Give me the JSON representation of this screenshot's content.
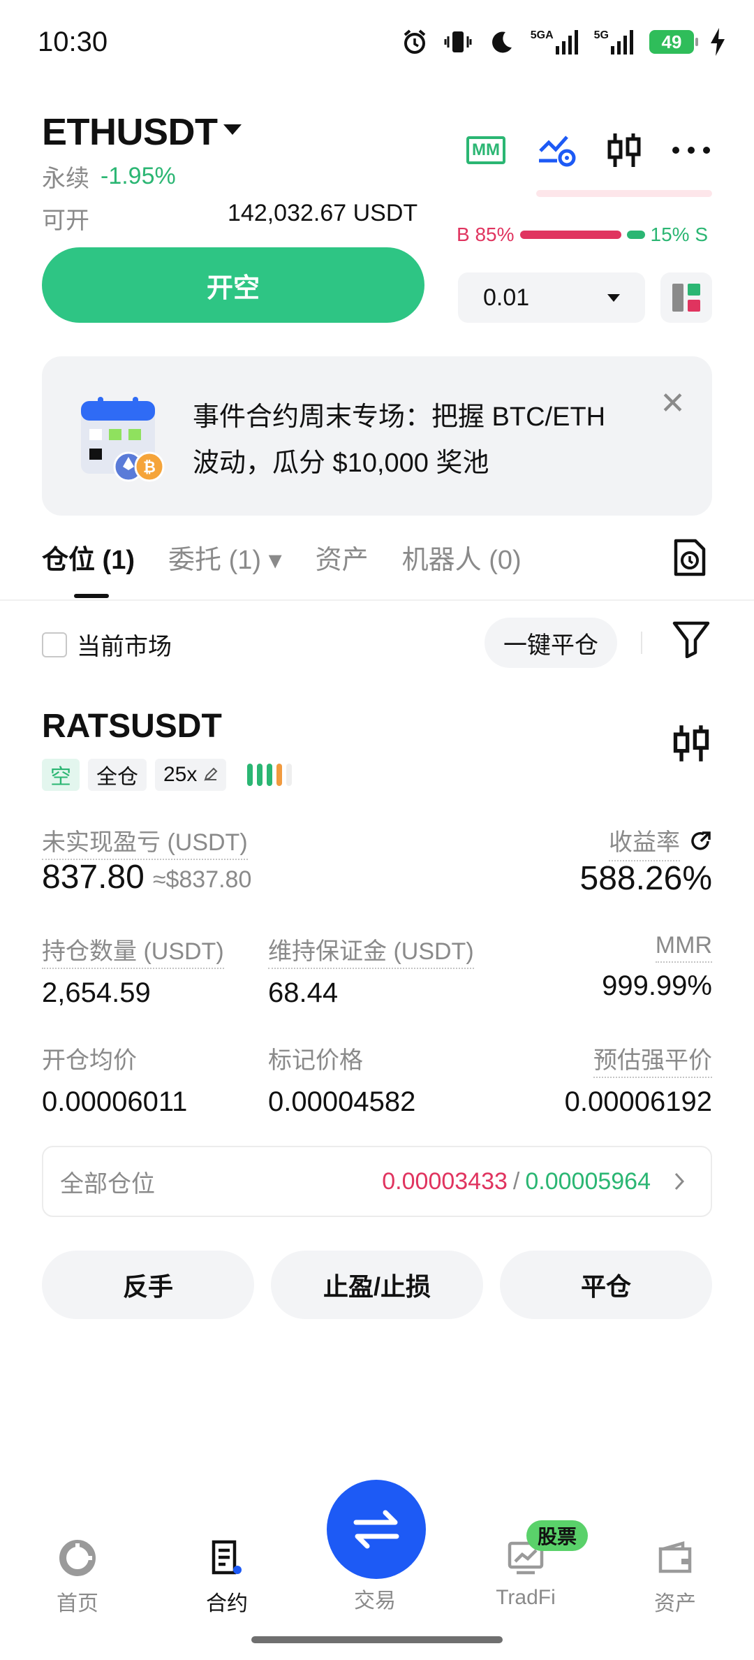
{
  "status_bar": {
    "time": "10:30",
    "battery": "49",
    "net1": "5GA",
    "net2": "5G"
  },
  "header": {
    "pair": "ETHUSDT",
    "perp_label": "永续",
    "change": "-1.95%",
    "avail_label": "可开",
    "avail_value": "142,032.67 USDT",
    "mm_label": "MM",
    "buy_ratio": "B 85%",
    "sell_ratio": "15% S",
    "buy_fraction": 0.85
  },
  "order": {
    "open_short_label": "开空",
    "qty": "0.01"
  },
  "banner": {
    "text_line1": "事件合约周末专场：把握 BTC/ETH",
    "text_line2": "波动，瓜分 $10,000 奖池",
    "close": "✕"
  },
  "tabs": [
    {
      "label": "仓位 (1)",
      "active": true
    },
    {
      "label": "委托 (1) ▾",
      "active": false
    },
    {
      "label": "资产",
      "active": false
    },
    {
      "label": "机器人 (0)",
      "active": false
    }
  ],
  "filter": {
    "current_market": "当前市场",
    "close_all": "一键平仓"
  },
  "position": {
    "symbol": "RATSUSDT",
    "side": "空",
    "margin_mode": "全仓",
    "leverage": "25x",
    "pnl_label": "未实现盈亏 (USDT)",
    "pnl_value": "837.80",
    "pnl_usd": "≈$837.80",
    "roe_label": "收益率",
    "roe_value": "588.26%",
    "size_label": "持仓数量 (USDT)",
    "size_value": "2,654.59",
    "maint_label": "维持保证金 (USDT)",
    "maint_value": "68.44",
    "mmr_label": "MMR",
    "mmr_value": "999.99%",
    "entry_label": "开仓均价",
    "entry_value": "0.00006011",
    "mark_label": "标记价格",
    "mark_value": "0.00004582",
    "liq_label": "预估强平价",
    "liq_value": "0.00006192"
  },
  "all_positions": {
    "label": "全部仓位",
    "val_red": "0.00003433",
    "sep": "/",
    "val_green": "0.00005964"
  },
  "actions": {
    "reverse": "反手",
    "tpsl": "止盈/止损",
    "close": "平仓"
  },
  "nav": {
    "home": "首页",
    "contract": "合约",
    "trade": "交易",
    "tradfi": "TradFi",
    "assets": "资产",
    "stock_badge": "股票"
  },
  "colors": {
    "green": "#2bb673",
    "red": "#e0345f",
    "orange": "#f19a3e",
    "blue": "#1d5af5"
  }
}
